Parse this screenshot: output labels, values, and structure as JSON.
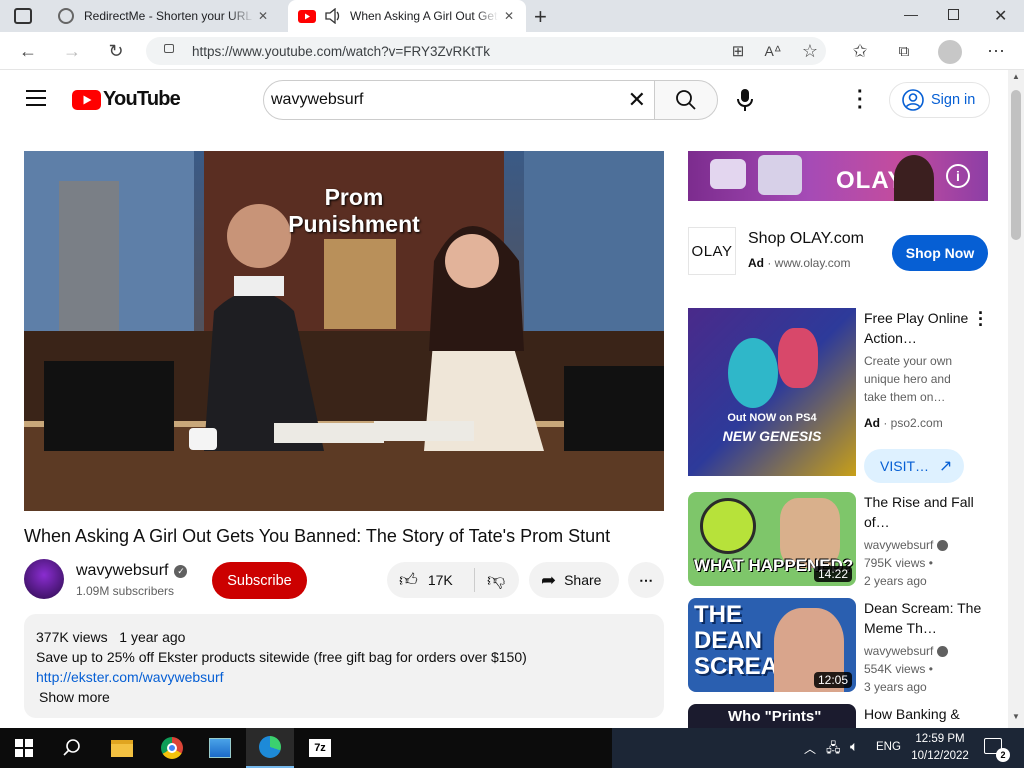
{
  "browser": {
    "tabs": [
      {
        "title": "RedirectMe - Shorten your URL",
        "icon": "redirectme-icon"
      },
      {
        "title": "When Asking A Girl Out Gets You Banned",
        "icon": "youtube-favicon"
      }
    ],
    "url": "https://www.youtube.com/watch?v=FRY3ZvRKtTk"
  },
  "youtube": {
    "logo_text": "YouTube",
    "search_value": "wavywebsurf",
    "signin_label": "Sign in"
  },
  "video": {
    "title": "When Asking A Girl Out Gets You Banned: The Story of Tate's Prom Stunt",
    "frame_caption_line1": "Prom",
    "frame_caption_line2": "Punishment",
    "channel": "wavywebsurf",
    "subscribers": "1.09M subscribers",
    "subscribe_label": "Subscribe",
    "likes": "17K",
    "share_label": "Share",
    "views": "377K views",
    "age": "1 year ago",
    "description": "Save up to 25% off Ekster products sitewide (free gift bag for orders over $150)",
    "link": "http://ekster.com/wavywebsurf",
    "show_more": "Show more"
  },
  "ad_banner": {
    "brand": "OLAY",
    "title": "Shop OLAY.com",
    "ad_label": "Ad",
    "domain": "www.olay.com",
    "cta": "Shop Now"
  },
  "sidebar": [
    {
      "title": "Free Play Online Action…",
      "line1": "Create your own",
      "line2": "unique hero and",
      "line3": "take them on…",
      "ad_label": "Ad",
      "domain": "pso2.com",
      "cta": "VISIT…",
      "thumb_text": "Out NOW on PS4",
      "thumb_text2": "NEW GENESIS"
    },
    {
      "title": "The Rise and Fall of…",
      "channel": "wavywebsurf",
      "views": "795K views",
      "age": "2 years ago",
      "duration": "14:22",
      "thumb_text": "WHAT HAPPENED?"
    },
    {
      "title": "Dean Scream: The Meme Th…",
      "channel": "wavywebsurf",
      "views": "554K views",
      "age": "3 years ago",
      "duration": "12:05",
      "thumb_text": "THE DEAN SCREAM"
    },
    {
      "title": "How Banking &",
      "thumb_text": "Who \"Prints\""
    }
  ],
  "taskbar": {
    "time": "12:59 PM",
    "date": "10/12/2022",
    "lang": "ENG",
    "notifications": "2"
  },
  "colors": {
    "youtube_red": "#ff0000",
    "subscribe_red": "#cc0000",
    "link_blue": "#065fd4",
    "shop_blue": "#065fd4"
  }
}
